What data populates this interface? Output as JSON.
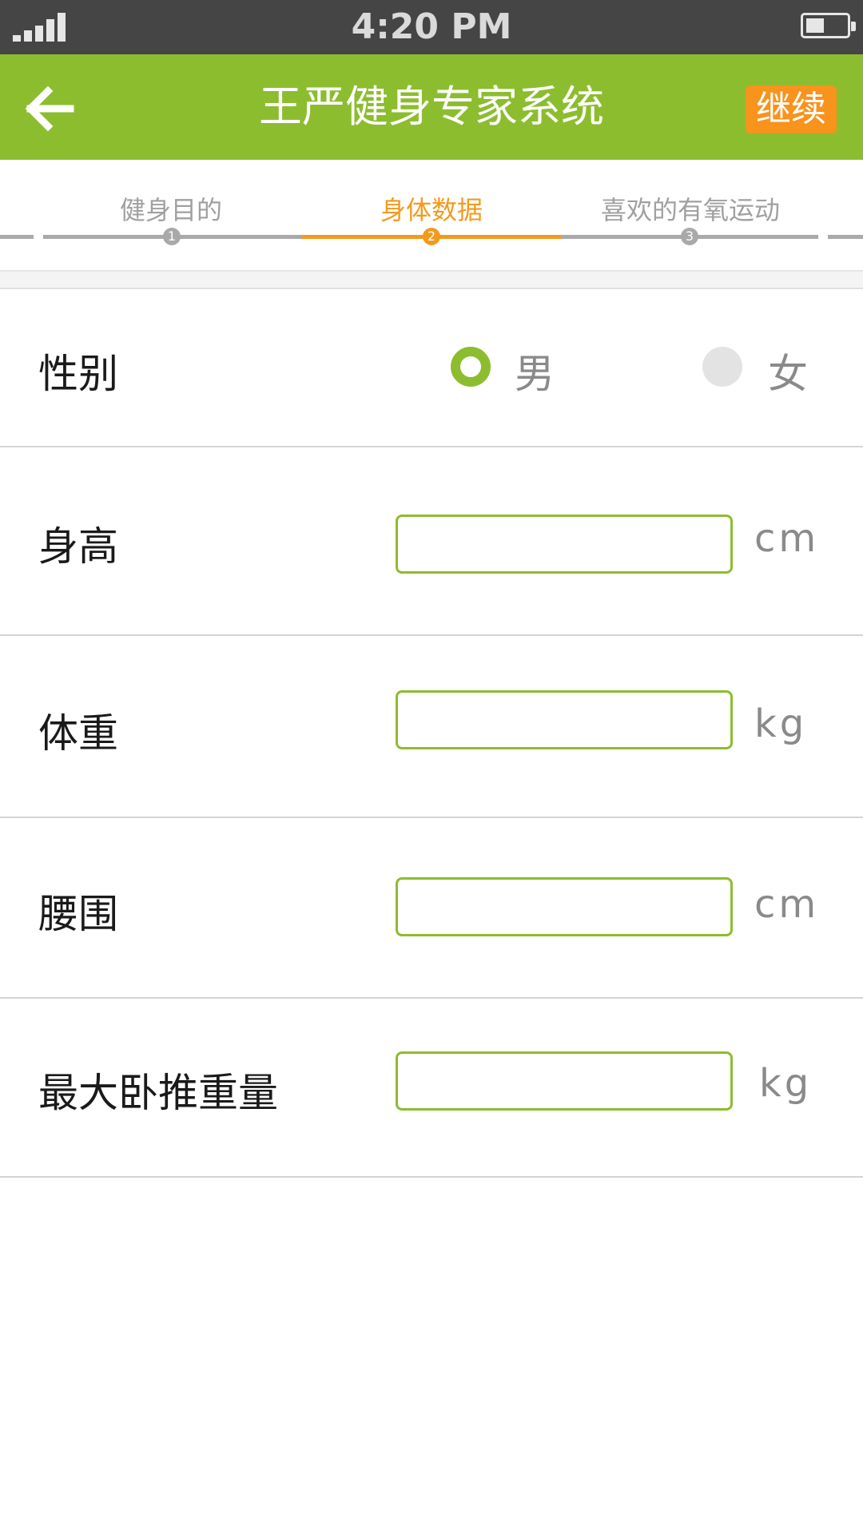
{
  "status_bar": {
    "time": "4:20 PM"
  },
  "header": {
    "title": "王严健身专家系统",
    "continue_label": "继续",
    "brand_color": "#8cbd2f",
    "accent_color": "#f8931d",
    "back_icon": "arrow-left-icon"
  },
  "stepper": {
    "steps": [
      {
        "label": "健身目的",
        "number": "1",
        "active": false
      },
      {
        "label": "身体数据",
        "number": "2",
        "active": true
      },
      {
        "label": "喜欢的有氧运动",
        "number": "3",
        "active": false
      }
    ],
    "active_color": "#f39a1d"
  },
  "form": {
    "gender": {
      "label": "性别",
      "options": [
        {
          "label": "男",
          "selected": true
        },
        {
          "label": "女",
          "selected": false
        }
      ]
    },
    "height": {
      "label": "身高",
      "value": "",
      "unit": "cm"
    },
    "weight": {
      "label": "体重",
      "value": "",
      "unit": "kg"
    },
    "waist": {
      "label": "腰围",
      "value": "",
      "unit": "cm"
    },
    "bench_press": {
      "label": "最大卧推重量",
      "value": "",
      "unit": "kg"
    }
  }
}
